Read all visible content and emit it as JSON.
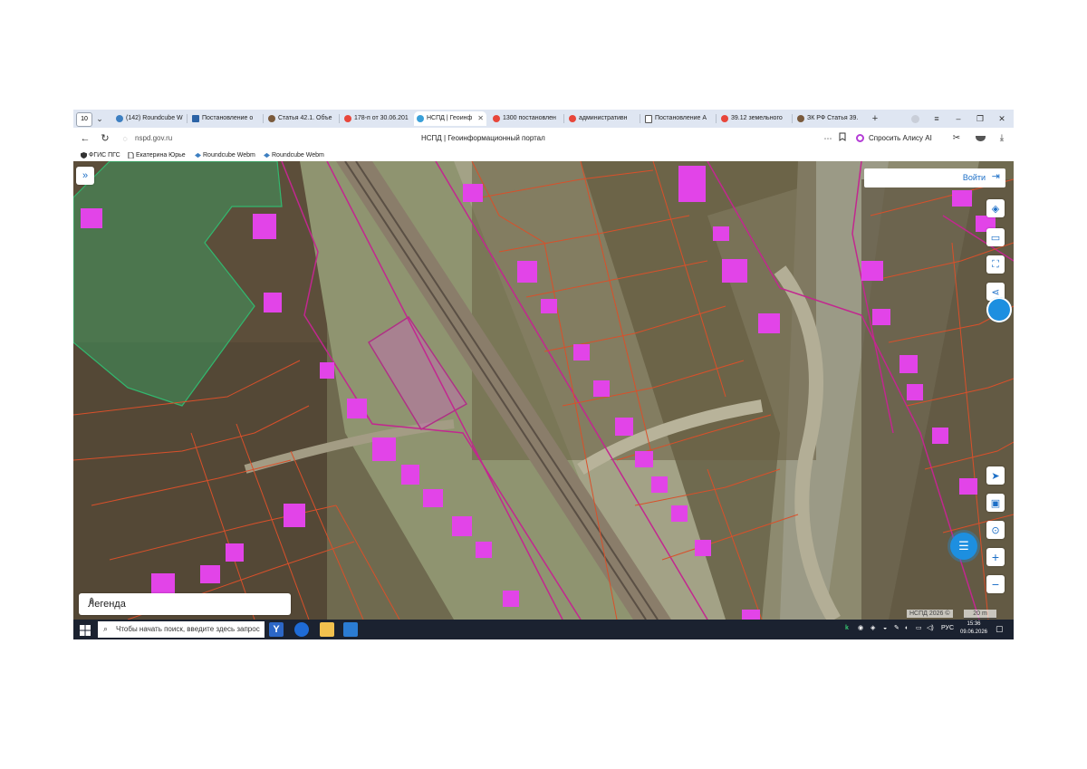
{
  "browser": {
    "tab_count": "10",
    "tabs": [
      {
        "label": "(142) Roundcube W",
        "color": "#3d7fc1"
      },
      {
        "label": "Постановление о",
        "color": "#2b63a6"
      },
      {
        "label": "Статья 42.1. Объе",
        "color": "#7a5a3c"
      },
      {
        "label": "178-п от 30.06.201",
        "color": "#e8463a"
      },
      {
        "label": "НСПД | Геоинф",
        "color": "#3aa0d8"
      },
      {
        "label": "1300 постановлен",
        "color": "#e8463a"
      },
      {
        "label": "административн",
        "color": "#e8463a"
      },
      {
        "label": "Постановление А",
        "color": "#555555"
      },
      {
        "label": "39.12 земельного",
        "color": "#e8463a"
      },
      {
        "label": "ЗК РФ Статья 39.",
        "color": "#7a5a3c"
      }
    ],
    "new_tab": "+",
    "window_controls": {
      "menu": "≡",
      "minimize": "–",
      "restore": "❐",
      "close": "✕"
    },
    "url": "nspd.gov.ru",
    "page_title": "НСПД | Геоинформационный портал",
    "alice_label": "Спросить Алису AI",
    "bookmarks": [
      {
        "label": "ФГИС ПГС",
        "icon": "shield-icon"
      },
      {
        "label": "Екатерина Юрье",
        "icon": "document-icon"
      },
      {
        "label": "Roundcube Webm",
        "icon": "roundcube-icon"
      },
      {
        "label": "Roundcube Webm",
        "icon": "roundcube-icon"
      }
    ]
  },
  "map": {
    "expand_icon": "»",
    "login_label": "Войти",
    "legend_label": "Легенда",
    "attribution": "НСПД 2026 ©",
    "scale_label": "20 m",
    "colors": {
      "parcel_border": "#d9502a",
      "zone_border": "#c2278f",
      "building": "#e244e8",
      "selected_parcel": "#c76ab8",
      "green_zone": "#32b86f"
    }
  },
  "taskbar": {
    "search_placeholder": "Чтобы начать поиск, введите здесь запрос",
    "lang": "РУС",
    "time": "15:36",
    "date": "09.06.2026"
  }
}
